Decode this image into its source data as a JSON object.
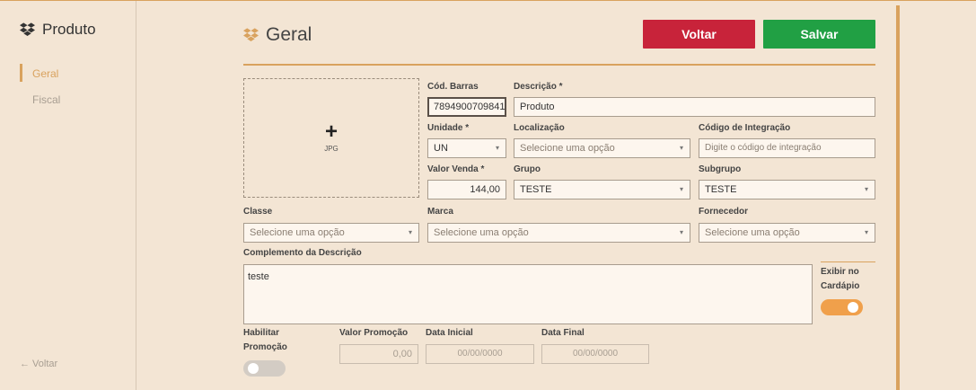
{
  "sidebar": {
    "title": "Produto",
    "icon": "dropbox-icon",
    "items": [
      {
        "label": "Geral",
        "active": true
      },
      {
        "label": "Fiscal",
        "active": false
      }
    ],
    "back_label": "← Voltar"
  },
  "header": {
    "title": "Geral",
    "icon": "dropbox-icon",
    "back_button": "Voltar",
    "save_button": "Salvar"
  },
  "colors": {
    "background": "#f3e5d4",
    "accent": "#d9a25e",
    "back_button": "#c8233a",
    "save_button": "#21a044",
    "toggle_on": "#f0a04b"
  },
  "photo": {
    "plus": "+",
    "format": "JPG"
  },
  "form": {
    "barcode": {
      "label": "Cód. Barras",
      "value": "7894900709841"
    },
    "description": {
      "label": "Descrição *",
      "value": "Produto"
    },
    "unit": {
      "label": "Unidade *",
      "value": "UN"
    },
    "location": {
      "label": "Localização",
      "placeholder": "Selecione uma opção"
    },
    "integration_code": {
      "label": "Código de Integração",
      "placeholder": "Digite o código de integração"
    },
    "price": {
      "label": "Valor Venda *",
      "value": "144,00"
    },
    "group": {
      "label": "Grupo",
      "value": "TESTE"
    },
    "subgroup": {
      "label": "Subgrupo",
      "value": "TESTE"
    },
    "class": {
      "label": "Classe",
      "placeholder": "Selecione uma opção"
    },
    "brand": {
      "label": "Marca",
      "placeholder": "Selecione uma opção"
    },
    "supplier": {
      "label": "Fornecedor",
      "placeholder": "Selecione uma opção"
    },
    "complement": {
      "label": "Complemento da Descrição",
      "value": "teste"
    },
    "show_menu": {
      "label_line1": "Exibir no",
      "label_line2": "Cardápio",
      "on": true
    },
    "enable_promo": {
      "label_line1": "Habilitar",
      "label_line2": "Promoção",
      "on": false
    },
    "promo_price": {
      "label": "Valor Promoção",
      "value": "0,00"
    },
    "start_date": {
      "label": "Data Inicial",
      "value": "00/00/0000"
    },
    "end_date": {
      "label": "Data Final",
      "value": "00/00/0000"
    }
  }
}
